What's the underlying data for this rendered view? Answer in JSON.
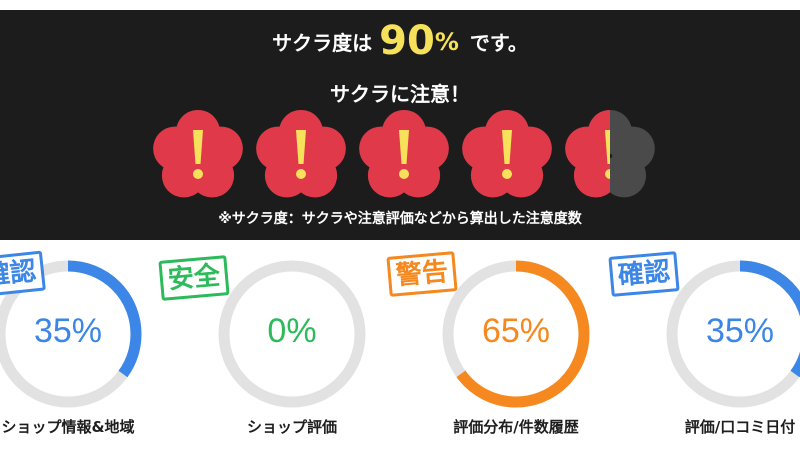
{
  "header": {
    "prefix": "サクラ度は",
    "percent": "90",
    "percent_sign": "%",
    "suffix": "です。",
    "warning": "サクラに注意！",
    "footnote": "※サクラ度：サクラや注意評価などから算出した注意度数",
    "blossom_level": 0.9,
    "blossom_total": 5
  },
  "colors": {
    "blossom": "#e0394a",
    "blossom_dim": "#4a4a4a",
    "exclamation": "#f6e25a",
    "ring_track": "#e2e2e2",
    "blue": "#3b86e6",
    "green": "#2cba5a",
    "orange": "#f5891f"
  },
  "gauges": [
    {
      "stamp": "確認",
      "value": 35,
      "display": "35%",
      "label": "ショップ情報&地域",
      "color": "#3b86e6"
    },
    {
      "stamp": "安全",
      "value": 0,
      "display": "0%",
      "label": "ショップ評価",
      "color": "#2cba5a"
    },
    {
      "stamp": "警告",
      "value": 65,
      "display": "65%",
      "label": "評価分布/件数履歴",
      "color": "#f5891f"
    },
    {
      "stamp": "確認",
      "value": 35,
      "display": "35%",
      "label": "評価/口コミ日付",
      "color": "#3b86e6"
    }
  ]
}
